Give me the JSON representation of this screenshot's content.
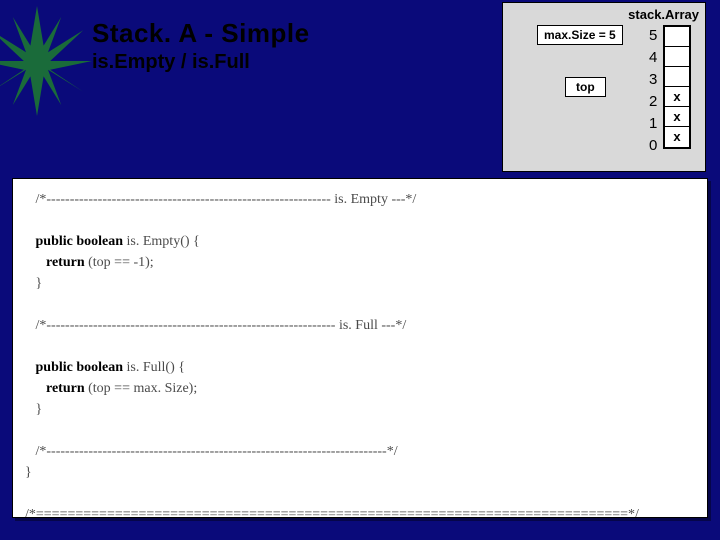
{
  "title": {
    "main": "Stack. A   -   Simple",
    "sub": "is.Empty / is.Full"
  },
  "diagram": {
    "label": "stack.Array",
    "maxsize": "max.Size = 5",
    "top": "top",
    "indices": [
      "5",
      "4",
      "3",
      "2",
      "1",
      "0"
    ],
    "cells": [
      "",
      "",
      "",
      "x",
      "x",
      "x"
    ]
  },
  "code": {
    "line1": "   /*------------------------------------------------------------- is. Empty ---*/",
    "line2": "",
    "line3a": "   public boolean",
    "line3b": " is. Empty() {",
    "line4a": "      return",
    "line4b": " (top == -1);",
    "line5": "   }",
    "line6": "",
    "line7": "   /*-------------------------------------------------------------- is. Full ---*/",
    "line8": "",
    "line9a": "   public boolean",
    "line9b": " is. Full() {",
    "line10a": "      return",
    "line10b": " (top == max. Size);",
    "line11": "   }",
    "line12": "",
    "line13": "   /*-------------------------------------------------------------------------*/",
    "line14": "}",
    "line15": "",
    "line16": "/*===========================================================================*/"
  }
}
